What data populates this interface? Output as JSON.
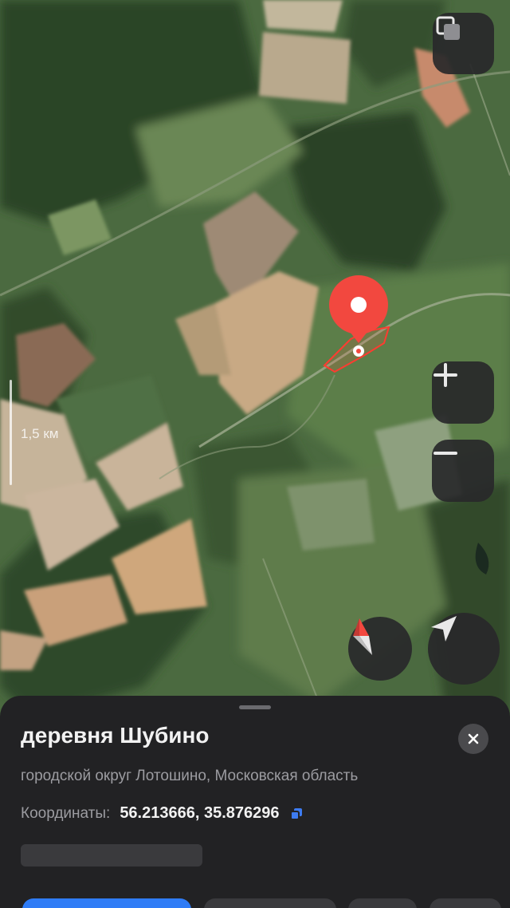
{
  "map": {
    "type": "satellite",
    "scale_label": "1,5 км",
    "colors": {
      "pin": "#f2483f",
      "area_outline": "#ff3b30",
      "forest": "#2f4a2a",
      "field_light": "#c9b08a",
      "meadow": "#5f7e4c"
    }
  },
  "controls": {
    "layers_icon": "layers-icon",
    "zoom_in_icon": "plus-icon",
    "zoom_out_icon": "minus-icon",
    "compass_icon": "compass-icon",
    "location_icon": "navigation-arrow-icon"
  },
  "place": {
    "title": "деревня Шубино",
    "subtitle": "городской округ Лотошино, Московская область",
    "coords_label": "Координаты:",
    "coords_value": "56.213666, 35.876296"
  },
  "theme": {
    "sheet_bg": "#222224",
    "accent": "#2f7cf6",
    "copy_icon_color": "#3d7bf0"
  }
}
